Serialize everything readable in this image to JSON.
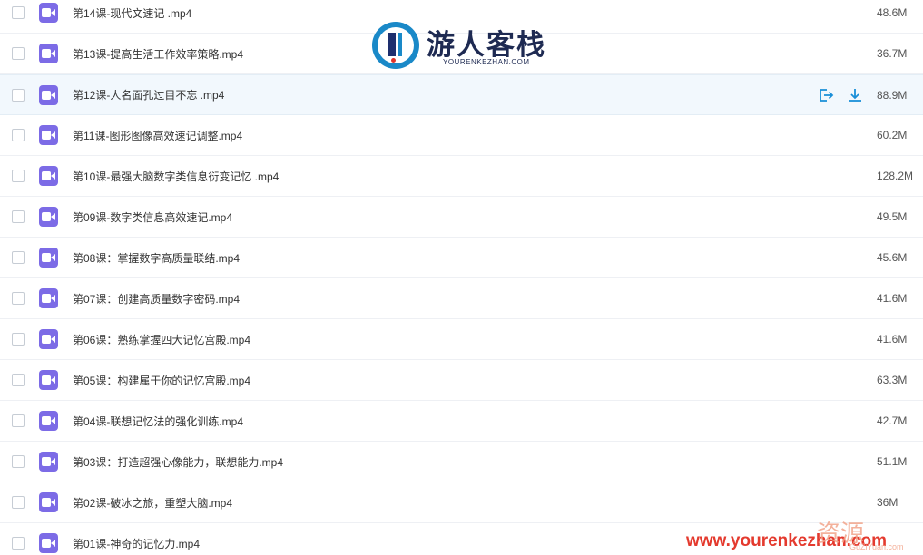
{
  "files": [
    {
      "name": "第14课-现代文速记 .mp4",
      "size": "48.6M"
    },
    {
      "name": "第13课-提高生活工作效率策略.mp4",
      "size": "36.7M"
    },
    {
      "name": "第12课-人名面孔过目不忘 .mp4",
      "size": "88.9M",
      "hovered": true
    },
    {
      "name": "第11课-图形图像高效速记调整.mp4",
      "size": "60.2M"
    },
    {
      "name": "第10课-最强大脑数字类信息衍变记忆 .mp4",
      "size": "128.2M"
    },
    {
      "name": "第09课-数字类信息高效速记.mp4",
      "size": "49.5M"
    },
    {
      "name": "第08课：掌握数字高质量联结.mp4",
      "size": "45.6M"
    },
    {
      "name": "第07课：创建高质量数字密码.mp4",
      "size": "41.6M"
    },
    {
      "name": "第06课：熟练掌握四大记忆宫殿.mp4",
      "size": "41.6M"
    },
    {
      "name": "第05课：构建属于你的记忆宫殿.mp4",
      "size": "63.3M"
    },
    {
      "name": "第04课-联想记忆法的强化训练.mp4",
      "size": "42.7M"
    },
    {
      "name": "第03课：打造超强心像能力，联想能力.mp4",
      "size": "51.1M"
    },
    {
      "name": "第02课-破冰之旅，重塑大脑.mp4",
      "size": "36M"
    },
    {
      "name": "第01课-神奇的记忆力.mp4",
      "size": ""
    }
  ],
  "row_icons": {
    "checkbox": "checkbox",
    "file_type": "video-file-icon",
    "actions": [
      "share-icon",
      "download-icon"
    ]
  },
  "watermark": {
    "logo_cn": "游人客栈",
    "logo_en": "YOURENKEZHAN.COM",
    "url": "www.yourenkezhan.com",
    "corner_cn": "资源",
    "corner_sub": "GuZiYuan.com"
  },
  "colors": {
    "accent": "#1a8fd8",
    "video_icon": "#7c6be6",
    "hover_row": "#f2f8fd",
    "watermark_red": "#e43a2e"
  }
}
